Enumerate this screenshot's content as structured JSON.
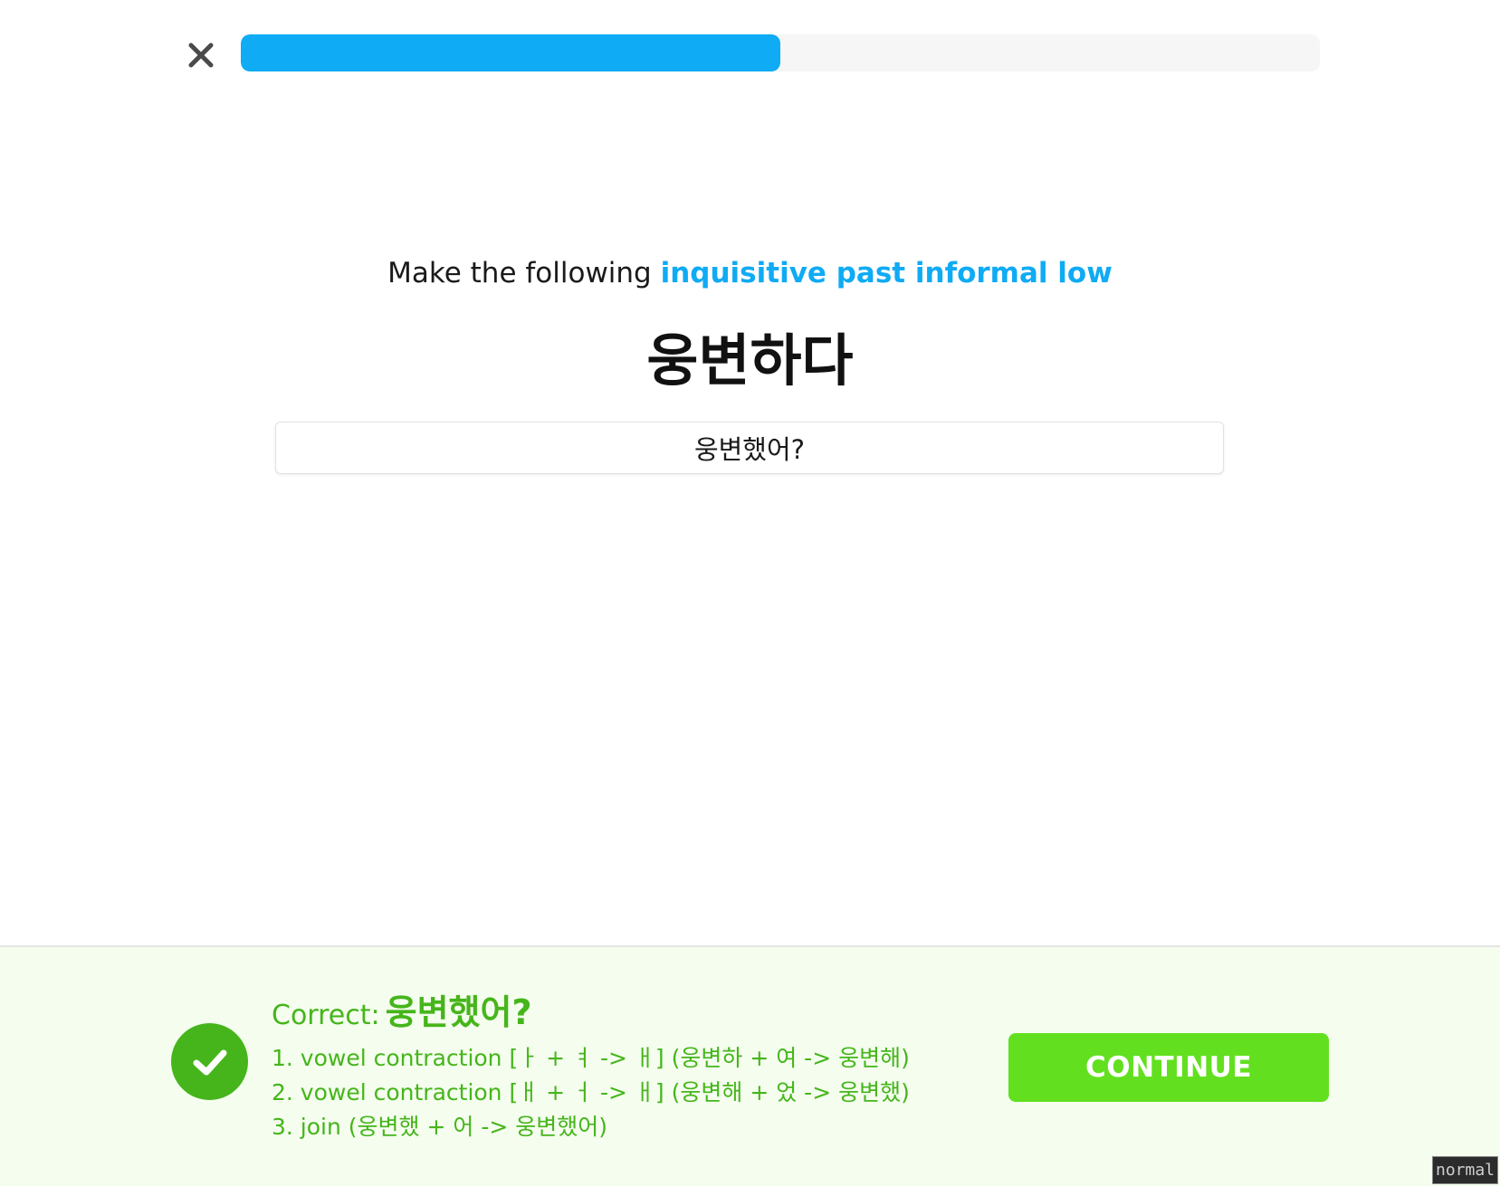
{
  "header": {
    "close_icon": "close-icon",
    "progress_fraction": 0.5
  },
  "prompt": {
    "lead": "Make the following ",
    "form": "inquisitive past informal low",
    "form_color": "#0fabf4"
  },
  "word": "웅변하다",
  "answer": {
    "value": "웅변했어?"
  },
  "feedback": {
    "status_icon": "check-circle-icon",
    "correct_label": "Correct:",
    "correct_answer": "웅변했어?",
    "steps": [
      "1. vowel contraction [ㅏ + ㅕ -> ㅐ] (웅변하 + 여 -> 웅변해)",
      "2. vowel contraction [ㅐ + ㅓ -> ㅐ] (웅변해 + 었 -> 웅변했)",
      "3. join (웅변했 + 어 -> 웅변했어)"
    ],
    "continue_label": "CONTINUE",
    "accent_color": "#46b51b",
    "button_color": "#62e01f"
  },
  "mode_badge": "normal"
}
